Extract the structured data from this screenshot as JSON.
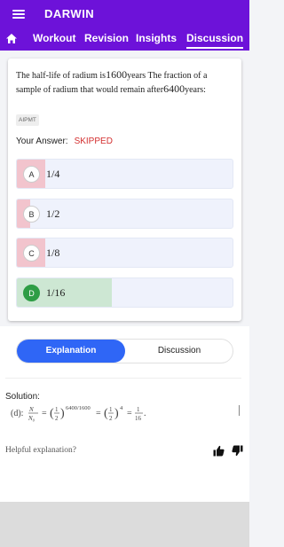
{
  "app": {
    "title": "DARWIN"
  },
  "tabs": [
    {
      "label": "Workout"
    },
    {
      "label": "Revision"
    },
    {
      "label": "Insights"
    },
    {
      "label": "Discussion"
    }
  ],
  "question": {
    "text_before": "The half-life of radium is",
    "half_life": "1600",
    "text_middle": "years The fraction of a sample of radium that would remain after",
    "time": "6400",
    "text_after": "years:",
    "tag": "AIPMT",
    "your_answer_label": "Your Answer:",
    "your_answer_status": "SKIPPED"
  },
  "options": [
    {
      "letter": "A",
      "text": "1/4",
      "fill_percent": 13,
      "correct": false
    },
    {
      "letter": "B",
      "text": "1/2",
      "fill_percent": 6,
      "correct": false
    },
    {
      "letter": "C",
      "text": "1/8",
      "fill_percent": 13,
      "correct": false
    },
    {
      "letter": "D",
      "text": "1/16",
      "fill_percent": 44,
      "correct": true
    }
  ],
  "segment": {
    "explanation": "Explanation",
    "discussion": "Discussion"
  },
  "solution": {
    "title": "Solution:",
    "prefix": "(d):"
  },
  "feedback": {
    "helpful": "Helpful explanation?"
  },
  "colors": {
    "appbar": "#6d12d9",
    "accent": "#2f66f6",
    "skipped": "#d32f2f",
    "correct": "#2e9d45",
    "wrong_fill": "#f2c4cd",
    "correct_fill": "#cde7d3"
  }
}
